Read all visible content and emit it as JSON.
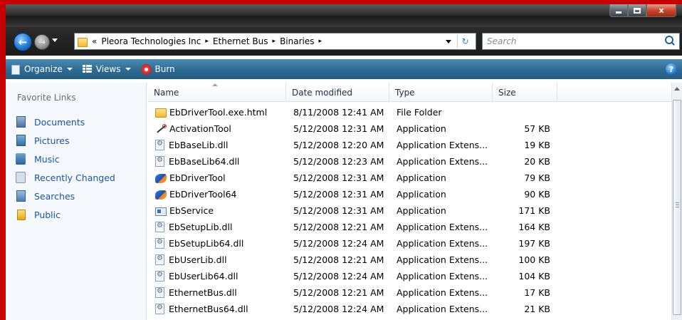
{
  "window": {
    "caption_buttons": [
      "minimize",
      "maximize",
      "close"
    ],
    "close_glyph": "x"
  },
  "navigation": {
    "back_glyph": "←",
    "forward_glyph": "→"
  },
  "address": {
    "overflow": "«",
    "breadcrumbs": [
      "Pleora Technologies Inc",
      "Ethernet Bus",
      "Binaries"
    ],
    "separator": "▸"
  },
  "search": {
    "placeholder": "Search"
  },
  "toolbar": {
    "organize_label": "Organize",
    "views_label": "Views",
    "burn_label": "Burn",
    "help_glyph": "?"
  },
  "nav_pane": {
    "title": "Favorite Links",
    "items": [
      {
        "label": "Documents",
        "icon": "documents-icon"
      },
      {
        "label": "Pictures",
        "icon": "pictures-icon"
      },
      {
        "label": "Music",
        "icon": "music-icon"
      },
      {
        "label": "Recently Changed",
        "icon": "recently-changed-icon"
      },
      {
        "label": "Searches",
        "icon": "searches-icon"
      },
      {
        "label": "Public",
        "icon": "public-folder-icon"
      }
    ]
  },
  "file_list": {
    "columns": [
      "Name",
      "Date modified",
      "Type",
      "Size"
    ],
    "rows": [
      {
        "name": "EbDriverTool.exe.html",
        "date": "8/11/2008 12:41 AM",
        "type": "File Folder",
        "size": "",
        "icon": "folder"
      },
      {
        "name": "ActivationTool",
        "date": "5/12/2008 12:31 AM",
        "type": "Application",
        "size": "57 KB",
        "icon": "tool"
      },
      {
        "name": "EbBaseLib.dll",
        "date": "5/12/2008 12:20 AM",
        "type": "Application Extens...",
        "size": "19 KB",
        "icon": "dll"
      },
      {
        "name": "EbBaseLib64.dll",
        "date": "5/12/2008 12:23 AM",
        "type": "Application Extens...",
        "size": "20 KB",
        "icon": "dll"
      },
      {
        "name": "EbDriverTool",
        "date": "5/12/2008 12:31 AM",
        "type": "Application",
        "size": "79 KB",
        "icon": "app"
      },
      {
        "name": "EbDriverTool64",
        "date": "5/12/2008 12:31 AM",
        "type": "Application",
        "size": "90 KB",
        "icon": "app"
      },
      {
        "name": "EbService",
        "date": "5/12/2008 12:31 AM",
        "type": "Application",
        "size": "171 KB",
        "icon": "service"
      },
      {
        "name": "EbSetupLib.dll",
        "date": "5/12/2008 12:21 AM",
        "type": "Application Extens...",
        "size": "164 KB",
        "icon": "dll"
      },
      {
        "name": "EbSetupLib64.dll",
        "date": "5/12/2008 12:24 AM",
        "type": "Application Extens...",
        "size": "197 KB",
        "icon": "dll"
      },
      {
        "name": "EbUserLib.dll",
        "date": "5/12/2008 12:21 AM",
        "type": "Application Extens...",
        "size": "100 KB",
        "icon": "dll"
      },
      {
        "name": "EbUserLib64.dll",
        "date": "5/12/2008 12:24 AM",
        "type": "Application Extens...",
        "size": "104 KB",
        "icon": "dll"
      },
      {
        "name": "EthernetBus.dll",
        "date": "5/12/2008 12:21 AM",
        "type": "Application Extens...",
        "size": "17 KB",
        "icon": "dll"
      },
      {
        "name": "EthernetBus64.dll",
        "date": "5/12/2008 12:24 AM",
        "type": "Application Extens...",
        "size": "21 KB",
        "icon": "dll"
      }
    ]
  }
}
